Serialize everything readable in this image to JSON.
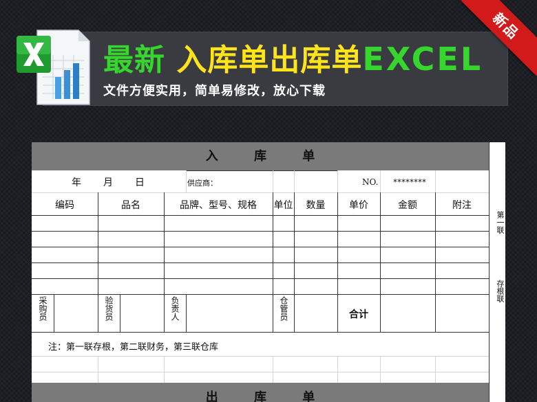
{
  "ribbon": "新品",
  "title": {
    "part1": "最新",
    "part2": "入库单出库单",
    "part3": "EXCEL"
  },
  "subtitle": "文件方便实用，简单易修改，放心下载",
  "sheet": {
    "title_chars": [
      "入",
      "库",
      "单"
    ],
    "date_year": "年",
    "date_month": "月",
    "date_day": "日",
    "supplier_label": "供应商：",
    "no_label": "NO.",
    "no_value": "********",
    "headers": [
      "编码",
      "品名",
      "品牌、型号、规格",
      "单位",
      "数量",
      "单价",
      "金额",
      "附注"
    ],
    "sign_purchaser": "采购员",
    "sign_inspector": "验货员",
    "sign_responsible": "负责人",
    "sign_keeper": "仓管员",
    "total_label": "合计",
    "note": "注：第一联存根，第二联财务，第三联仓库",
    "side_first": "第一联",
    "side_stub": "存根联",
    "title2_chars": [
      "出",
      "库",
      "单"
    ]
  },
  "colors": {
    "background": "#1e1f24",
    "banner": "#3a3b41",
    "title_green": "#37d62e",
    "title_yellow": "#ffe41a",
    "ribbon": "#d21a1a",
    "sheet_title_bar": "#7a7a7a"
  },
  "icons": [
    "excel-file-icon"
  ]
}
